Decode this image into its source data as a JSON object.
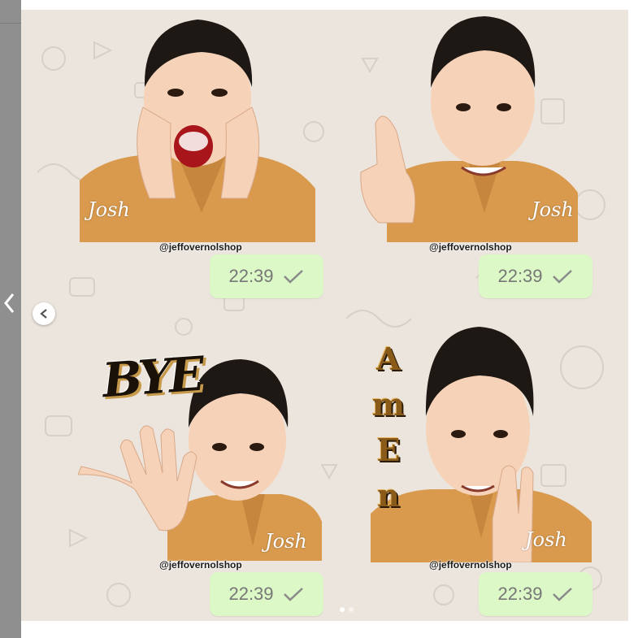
{
  "stickers": [
    {
      "watermark": "@jeffovernolshop",
      "signature": "Josh",
      "time": "22:39"
    },
    {
      "watermark": "@jeffovernolshop",
      "signature": "Josh",
      "time": "22:39"
    },
    {
      "watermark": "@jeffovernolshop",
      "signature": "Josh",
      "time": "22:39",
      "caption": "BYE"
    },
    {
      "watermark": "@jeffovernolshop",
      "signature": "Josh",
      "time": "22:39",
      "caption_letters": [
        "A",
        "m",
        "E",
        "n"
      ]
    }
  ],
  "colors": {
    "chat_background": "#ece5dd",
    "bubble": "#dcf8c6",
    "time_text": "#777777",
    "checkmark": "#8a8a8a",
    "shirt": "#d99a4e",
    "skin": "#f6d2b8",
    "hair": "#1e1814"
  },
  "icons": {
    "prev": "chevron-left-icon",
    "carousel_prev": "carousel-prev-icon",
    "read_receipt": "checkmark-icon"
  },
  "carousel": {
    "dot_count": 2,
    "active_index": 0
  }
}
